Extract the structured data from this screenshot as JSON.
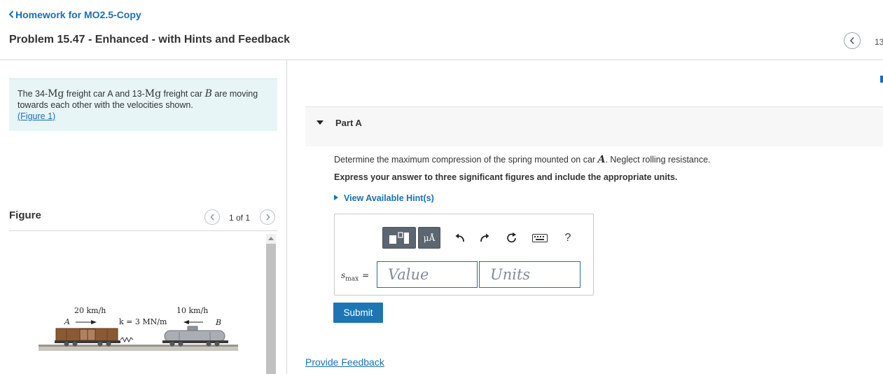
{
  "header": {
    "back_link": "Homework for MO2.5-Copy",
    "problem_title": "Problem 15.47 - Enhanced - with Hints and Feedback",
    "nav_count": "13"
  },
  "statement": {
    "part1": "The 34-",
    "unit1": "Mg",
    "part2": " freight car A and 13-",
    "unit2": "Mg",
    "part3": " freight car ",
    "car_b": "B",
    "part4": " are moving towards each other with the velocities shown.",
    "figure_link": "(Figure 1)"
  },
  "figure": {
    "label": "Figure",
    "count": "1 of 1",
    "velocity_a": "20 km/h",
    "velocity_b": "10 km/h",
    "car_a_label": "A",
    "car_b_label": "B",
    "spring_label": "k = 3 MN/m"
  },
  "part_a": {
    "title": "Part A",
    "question_pre": "Determine the maximum compression of the spring mounted on car ",
    "question_sym": "A",
    "question_post": ". Neglect rolling resistance.",
    "instruction": "Express your answer to three significant figures and include the appropriate units.",
    "hints_label": "View Available Hint(s)",
    "units_button": "μÅ",
    "help_button": "?",
    "answer_var": "s",
    "answer_sub": "max",
    "answer_eq": "=",
    "value_placeholder": "Value",
    "units_placeholder": "Units",
    "submit_label": "Submit"
  },
  "footer": {
    "feedback_link": "Provide Feedback"
  },
  "colors": {
    "link": "#1a6fb4",
    "statement_bg": "#e8f5f7",
    "submit_bg": "#1d76b3",
    "toolbar_dark": "#5b6670"
  }
}
